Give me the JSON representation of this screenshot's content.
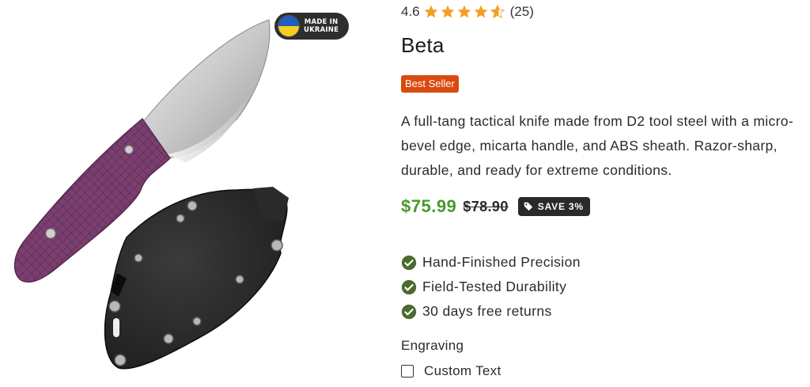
{
  "gallery": {
    "image_alt": "Beta tactical knife with purple micarta handle and black ABS sheath",
    "badge": {
      "line1": "MADE IN",
      "line2": "UKRAINE",
      "flag_colors": [
        "#1f5fbf",
        "#f6cf1e"
      ]
    }
  },
  "product": {
    "rating": {
      "score": "4.6",
      "stars": 4.6,
      "max_stars": 5,
      "count": "(25)"
    },
    "title": "Beta",
    "badge": "Best Seller",
    "description": "A full-tang tactical knife made from D2 tool steel with a micro-bevel edge, micarta handle, and ABS sheath. Razor-sharp, durable, and ready for extreme conditions.",
    "price": {
      "current": "$75.99",
      "original": "$78.90",
      "save_label": "SAVE 3%"
    },
    "features": [
      {
        "icon": "check-circle-icon",
        "text": "Hand-Finished Precision"
      },
      {
        "icon": "check-circle-icon",
        "text": "Field-Tested Durability"
      },
      {
        "icon": "check-circle-icon",
        "text": "30 days free returns"
      }
    ],
    "engraving": {
      "label": "Engraving",
      "option_label": "Custom Text",
      "checked": false
    }
  },
  "colors": {
    "accent_green": "#4a9a2b",
    "bestseller_orange": "#d94a0f",
    "star_orange": "#f2a024",
    "check_green": "#4c6b2f",
    "handle_purple": "#7a3f6e"
  }
}
